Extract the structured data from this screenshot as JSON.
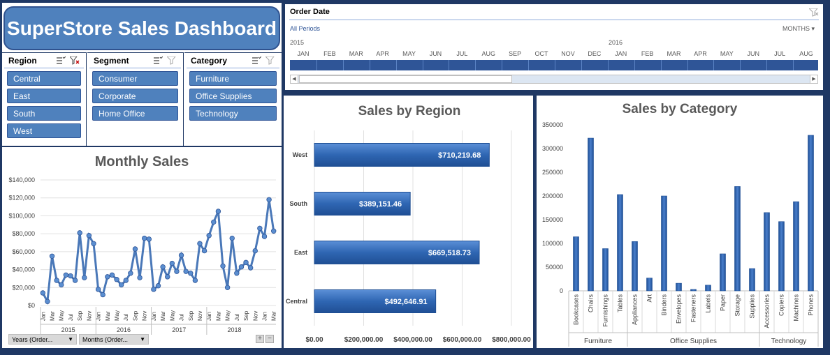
{
  "title": "SuperStore Sales Dashboard",
  "slicers": {
    "region": {
      "label": "Region",
      "items": [
        "Central",
        "East",
        "South",
        "West"
      ]
    },
    "segment": {
      "label": "Segment",
      "items": [
        "Consumer",
        "Corporate",
        "Home Office"
      ]
    },
    "category": {
      "label": "Category",
      "items": [
        "Furniture",
        "Office Supplies",
        "Technology"
      ]
    }
  },
  "timeline": {
    "label": "Order Date",
    "period": "All Periods",
    "level": "MONTHS",
    "year1": "2015",
    "year2": "2016",
    "months": [
      "JAN",
      "FEB",
      "MAR",
      "APR",
      "MAY",
      "JUN",
      "JUL",
      "AUG",
      "SEP",
      "OCT",
      "NOV",
      "DEC",
      "JAN",
      "FEB",
      "MAR",
      "APR",
      "MAY",
      "JUN",
      "JUL",
      "AUG"
    ]
  },
  "monthly": {
    "title": "Monthly Sales",
    "filter1": "Years (Order...",
    "filter2": "Months (Order...",
    "plus": "+",
    "minus": "−"
  },
  "colors": {
    "accent": "#4f81bd",
    "dark": "#1f3864",
    "bar": "#2e62a8"
  },
  "chart_data": [
    {
      "type": "line",
      "title": "Monthly Sales",
      "ylim": [
        0,
        140000
      ],
      "yticks": [
        "$0",
        "$20,000",
        "$40,000",
        "$60,000",
        "$80,000",
        "$100,000",
        "$120,000",
        "$140,000"
      ],
      "month_labels": [
        "Jan",
        "Mar",
        "May",
        "Jul",
        "Sep",
        "Nov"
      ],
      "years": [
        "2015",
        "2016",
        "2017",
        "2018"
      ],
      "values": [
        14000,
        4500,
        55000,
        28000,
        23000,
        34000,
        33000,
        28000,
        81000,
        31000,
        78000,
        69000,
        18000,
        12000,
        32000,
        34000,
        29000,
        23000,
        28000,
        36000,
        63000,
        31000,
        75000,
        74000,
        18000,
        22000,
        43000,
        32000,
        47000,
        38000,
        56000,
        38000,
        36000,
        28000,
        69000,
        61000,
        78000,
        93000,
        105000,
        44000,
        20000,
        75000,
        36000,
        43000,
        48000,
        42000,
        61000,
        86000,
        77000,
        118000,
        83000
      ]
    },
    {
      "type": "bar",
      "title": "Sales by Region",
      "categories": [
        "West",
        "South",
        "East",
        "Central"
      ],
      "values": [
        710219.68,
        389151.46,
        669518.73,
        492646.91
      ],
      "labels": [
        "$710,219.68",
        "$389,151.46",
        "$669,518.73",
        "$492,646.91"
      ],
      "xlim": [
        0,
        800000
      ],
      "xticks": [
        "$0.00",
        "$200,000.00",
        "$400,000.00",
        "$600,000.00",
        "$800,000.00"
      ]
    },
    {
      "type": "bar",
      "title": "Sales by Category",
      "ylim": [
        0,
        350000
      ],
      "yticks": [
        "0",
        "50000",
        "100000",
        "150000",
        "200000",
        "250000",
        "300000",
        "350000"
      ],
      "groups": [
        {
          "name": "Furniture",
          "categories": [
            "Bookcases",
            "Chairs",
            "Furnishings",
            "Tables"
          ],
          "values": [
            114000,
            322000,
            89000,
            203000
          ]
        },
        {
          "name": "Office Supplies",
          "categories": [
            "Appliances",
            "Art",
            "Binders",
            "Envelopes",
            "Fasteners",
            "Labels",
            "Paper",
            "Storage",
            "Supplies"
          ],
          "values": [
            104000,
            27000,
            200000,
            16000,
            3000,
            12000,
            78000,
            220000,
            47000
          ]
        },
        {
          "name": "Technology",
          "categories": [
            "Accessories",
            "Copiers",
            "Machines",
            "Phones"
          ],
          "values": [
            165000,
            146000,
            188000,
            328000
          ]
        }
      ]
    }
  ]
}
